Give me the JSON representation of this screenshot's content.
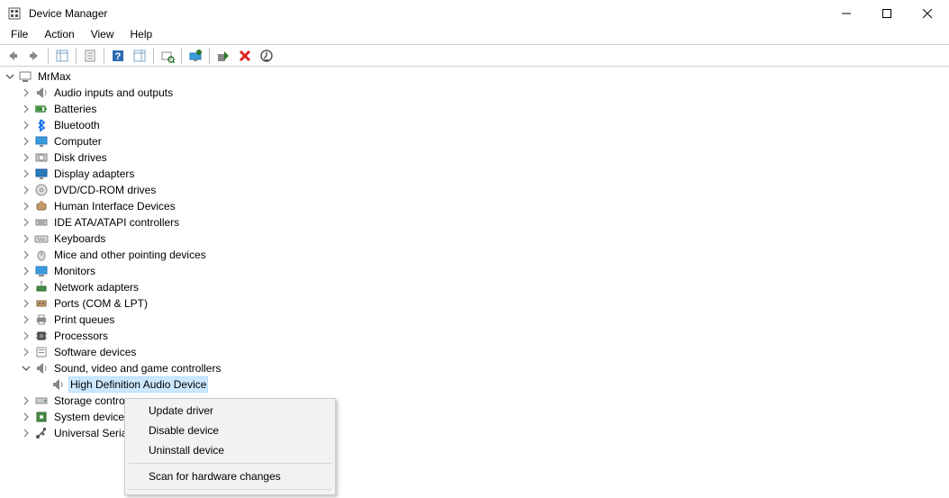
{
  "window": {
    "title": "Device Manager"
  },
  "menu": {
    "file": "File",
    "action": "Action",
    "view": "View",
    "help": "Help"
  },
  "toolbar": {
    "back": "Back",
    "forward": "Forward",
    "show_hide_tree": "Show/Hide Console Tree",
    "properties": "Properties",
    "help": "Help",
    "show_hide_action_pane": "Show/Hide Action Pane",
    "scan": "Scan for hardware changes",
    "update": "Update device drivers",
    "enable": "Enable device",
    "uninstall": "Uninstall device",
    "legacy": "Add legacy hardware"
  },
  "tree": {
    "root": "MrMax",
    "categories": [
      {
        "label": "Audio inputs and outputs",
        "icon": "speaker"
      },
      {
        "label": "Batteries",
        "icon": "battery"
      },
      {
        "label": "Bluetooth",
        "icon": "bluetooth"
      },
      {
        "label": "Computer",
        "icon": "monitor"
      },
      {
        "label": "Disk drives",
        "icon": "disk"
      },
      {
        "label": "Display adapters",
        "icon": "display"
      },
      {
        "label": "DVD/CD-ROM drives",
        "icon": "cd"
      },
      {
        "label": "Human Interface Devices",
        "icon": "hid"
      },
      {
        "label": "IDE ATA/ATAPI controllers",
        "icon": "ide"
      },
      {
        "label": "Keyboards",
        "icon": "keyboard"
      },
      {
        "label": "Mice and other pointing devices",
        "icon": "mouse"
      },
      {
        "label": "Monitors",
        "icon": "monitor2"
      },
      {
        "label": "Network adapters",
        "icon": "network"
      },
      {
        "label": "Ports (COM & LPT)",
        "icon": "port"
      },
      {
        "label": "Print queues",
        "icon": "printer"
      },
      {
        "label": "Processors",
        "icon": "cpu"
      },
      {
        "label": "Software devices",
        "icon": "software"
      },
      {
        "label": "Sound, video and game controllers",
        "icon": "sound",
        "expanded": true,
        "children": [
          {
            "label": "High Definition Audio Device",
            "icon": "speaker",
            "selected": true
          }
        ]
      },
      {
        "label": "Storage contro",
        "icon": "storage"
      },
      {
        "label": "System device",
        "icon": "system"
      },
      {
        "label": "Universal Seria",
        "icon": "usb"
      }
    ]
  },
  "context_menu": {
    "update_driver": "Update driver",
    "disable_device": "Disable device",
    "uninstall_device": "Uninstall device",
    "scan": "Scan for hardware changes"
  }
}
